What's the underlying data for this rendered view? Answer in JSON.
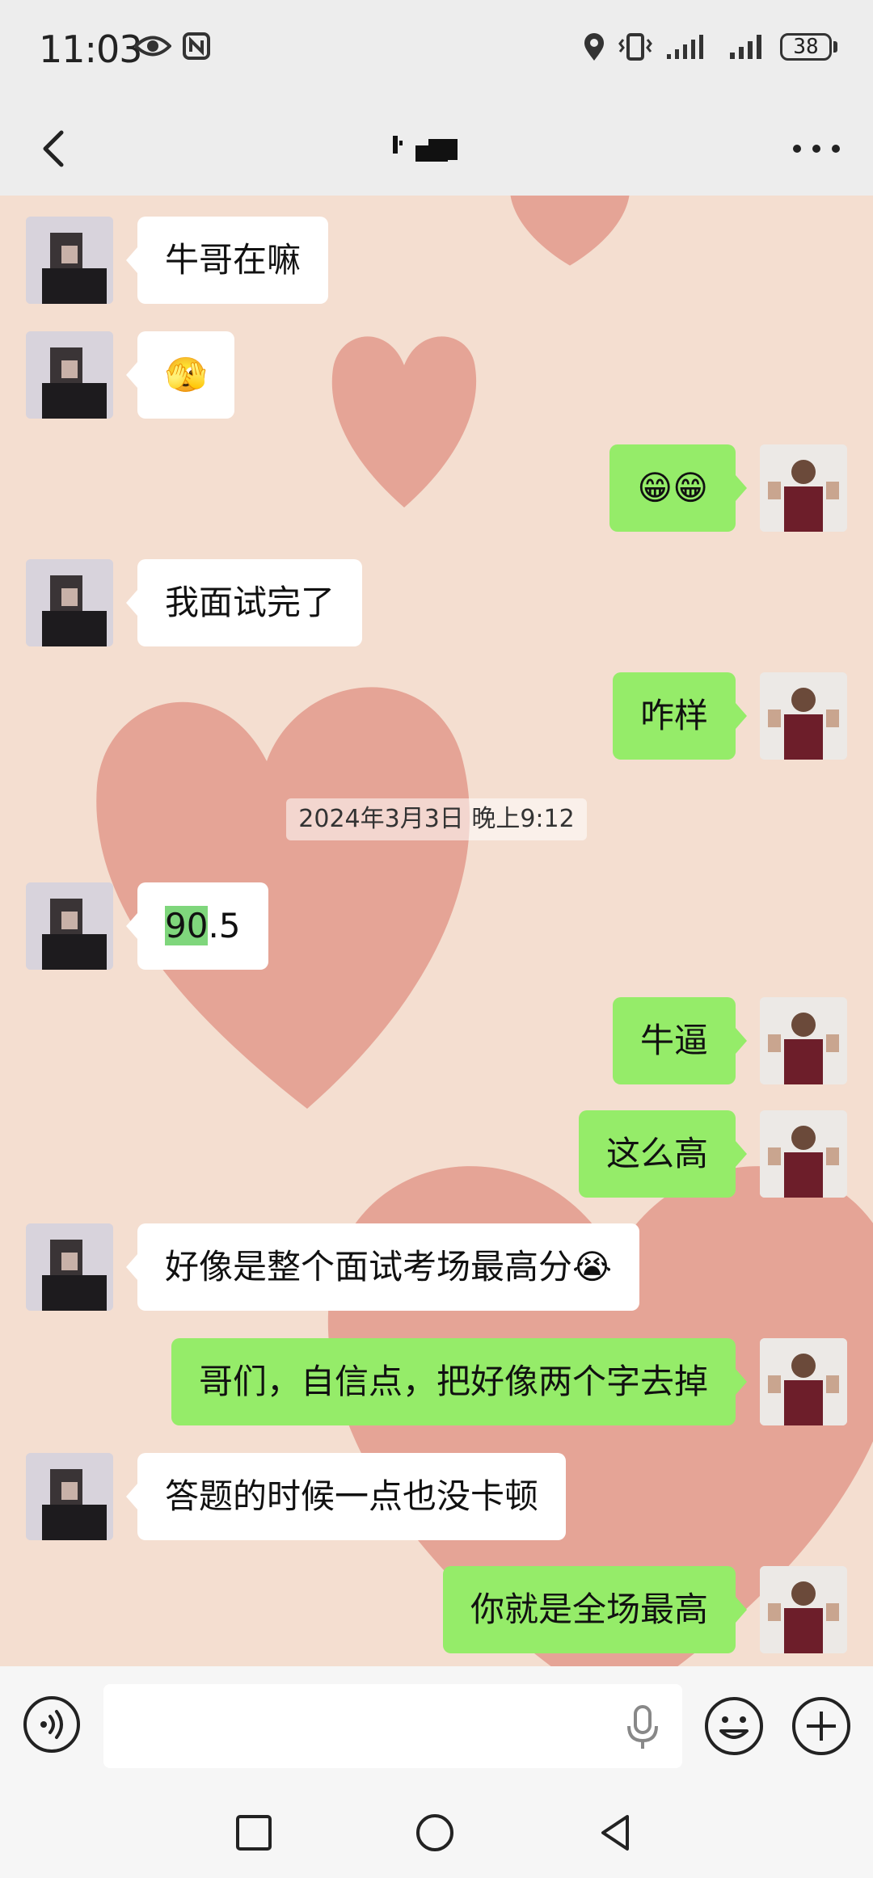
{
  "status_bar": {
    "time": "11:03",
    "battery": "38",
    "left_icons": [
      "eye-icon",
      "nfc-icon"
    ],
    "right_icons": [
      "location-icon",
      "vibrate-icon",
      "signal-icon",
      "signal-icon",
      "battery-icon"
    ]
  },
  "header": {
    "back_icon": "chevron-left-icon",
    "more_icon": "more-dots-icon"
  },
  "messages": [
    {
      "side": "in",
      "text": "牛哥在嘛"
    },
    {
      "side": "in",
      "emoji": "🫣"
    },
    {
      "side": "out",
      "emoji": "😁😁"
    },
    {
      "side": "in",
      "text": "我面试完了"
    },
    {
      "side": "out",
      "text": "咋样"
    },
    {
      "side": "in",
      "text_highlight": "90",
      "text_rest": ".5"
    },
    {
      "side": "out",
      "text": "牛逼"
    },
    {
      "side": "out",
      "text": "这么高"
    },
    {
      "side": "in",
      "text": "好像是整个面试考场最高分",
      "emoji": "😭"
    },
    {
      "side": "out",
      "text": "哥们，自信点，把好像两个字去掉"
    },
    {
      "side": "in",
      "text": "答题的时候一点也没卡顿"
    },
    {
      "side": "out",
      "text": "你就是全场最高"
    }
  ],
  "timestamp": "2024年3月3日 晚上9:12",
  "input_bar": {
    "value": "",
    "icons": [
      "voice-icon",
      "mic-icon",
      "emoji-icon",
      "plus-icon"
    ]
  },
  "colors": {
    "outgoing_bubble": "#95ec69",
    "incoming_bubble": "#ffffff",
    "chat_background": "#f4ded0",
    "heart": "#e29a8c"
  }
}
